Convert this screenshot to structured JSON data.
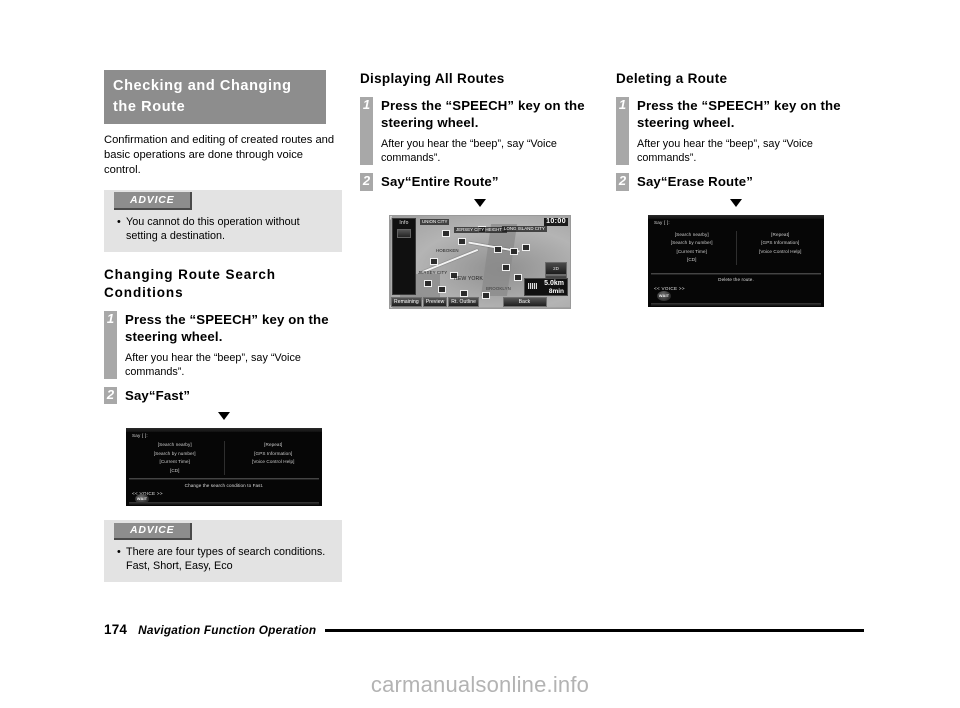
{
  "footer": {
    "page_number": "174",
    "title": "Navigation Function Operation"
  },
  "watermark": "carmanualsonline.info",
  "columns": {
    "left": {
      "banner_title": "Checking and Changing the Route",
      "intro": "Confirmation and editing of created routes and basic operations are done through voice control.",
      "advice_top": {
        "label": "ADVICE",
        "bullet": "•",
        "text": "You cannot do this operation without setting a destination."
      },
      "section_title": "Changing Route Search Conditions",
      "steps": [
        {
          "number": "1",
          "title": "Press the “SPEECH” key on the steering wheel.",
          "body": "After you hear the “beep”, say “Voice commands”."
        },
        {
          "number": "2",
          "title": "Say“Fast”",
          "body": ""
        }
      ],
      "arrow": "▼",
      "screen": {
        "say_prompt": "Say [ ]:",
        "left_items": [
          "[Search nearby]",
          "[Search by number]",
          "[Current Time]",
          "[CD]"
        ],
        "right_items": [
          "[Repeat]",
          "[GPS Information]",
          "[Voice Control Help]"
        ],
        "message": "Change the search condition to Fast.",
        "voice_label": "<< VOICE >>",
        "wait_button": "WAIT"
      },
      "advice_bottom": {
        "label": "ADVICE",
        "bullet": "•",
        "text": "There are four types of search conditions. Fast, Short, Easy, Eco"
      }
    },
    "middle": {
      "section_title": "Displaying All Routes",
      "steps": [
        {
          "number": "1",
          "title": "Press the “SPEECH” key on the steering wheel.",
          "body": "After you hear the “beep”, say “Voice commands”."
        },
        {
          "number": "2",
          "title": "Say“Entire Route”",
          "body": ""
        }
      ],
      "arrow": "▼",
      "map_screen": {
        "clock": "10:00",
        "info_panel_title": "Info",
        "top_labels": [
          "UNION CITY",
          "JERSEY CITY HEIGHTS",
          "LONG ISLAND CITY"
        ],
        "map_labels": [
          "HOBOKEN",
          "JERSEY CITY",
          "NEW YORK",
          "BROOKLYN"
        ],
        "side_buttons": [
          "2D",
          "5 km"
        ],
        "eta_distance": "5.0km",
        "eta_time": "8min",
        "buttons": [
          "Remaining",
          "Preview",
          "Rt. Outline",
          "Back"
        ]
      }
    },
    "right": {
      "section_title": "Deleting a Route",
      "steps": [
        {
          "number": "1",
          "title": "Press the “SPEECH” key on the steering wheel.",
          "body": "After you hear the “beep”, say “Voice commands”."
        },
        {
          "number": "2",
          "title": "Say“Erase Route”",
          "body": ""
        }
      ],
      "arrow": "▼",
      "screen": {
        "say_prompt": "Say [ ]:",
        "left_items": [
          "[Search nearby]",
          "[Search by number]",
          "[Current Time]",
          "[CD]"
        ],
        "right_items": [
          "[Repeat]",
          "[GPS Information]",
          "[Voice Control Help]"
        ],
        "message": "Delete the route.",
        "voice_label": "<< VOICE >>",
        "wait_button": "WAIT"
      }
    }
  }
}
